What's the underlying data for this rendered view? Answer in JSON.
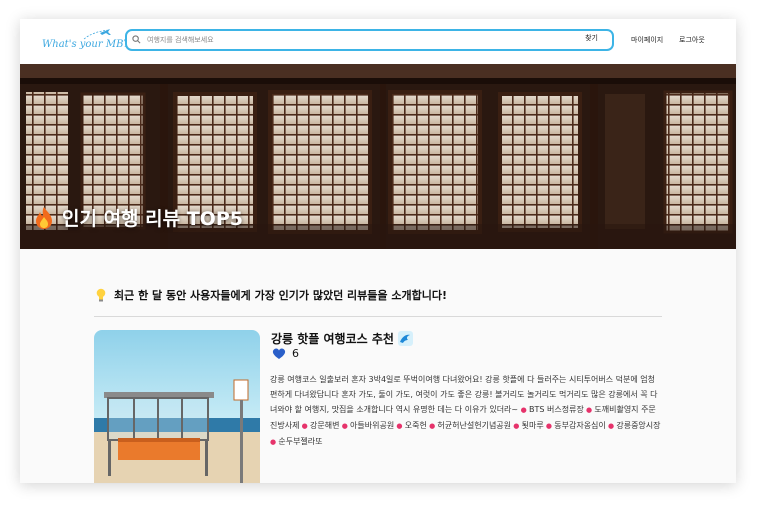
{
  "header": {
    "logo_text": "What's your MBTI",
    "search_placeholder": "여행지를 검색해보세요",
    "search_button": "찾기",
    "nav": [
      "마이페이지",
      "로그아웃"
    ]
  },
  "hero": {
    "title": "인기 여행 리뷰 TOP5"
  },
  "intro": {
    "text": "최근 한 달 동안 사용자들에게 가장 인기가 많았던 리뷰들을 소개합니다!"
  },
  "review": {
    "title": "강릉 핫플 여행코스 추천",
    "likes": "6",
    "description": "강릉 여행코스 일출보러 혼자 3박4일로 뚜벅이여행 다녀왔어요! 강릉 핫플에 다 들러주는 시티투어버스 덕분에 엄청 편하게 다녀왔답니다 혼자 가도, 둘이 가도, 여럿이 가도 좋은 강릉! 볼거리도 놀거리도 먹거리도 많은 강릉에서 꼭 다녀와야 할 여행지, 맛집을 소개합니다 역시 유명한 데는 다 이유가 있더라~",
    "places": [
      "BTS 버스정류장",
      "도깨비촬영지 주문진방사제",
      "강문해변",
      "아들바위공원",
      "오죽헌",
      "허균허난설헌기념공원",
      "툇마루",
      "동부감자옹심이",
      "강릉중앙시장",
      "순두부젤라또"
    ]
  },
  "colors": {
    "accent": "#3db4e6",
    "logo": "#3da8e0",
    "pin": "#e6336b"
  }
}
